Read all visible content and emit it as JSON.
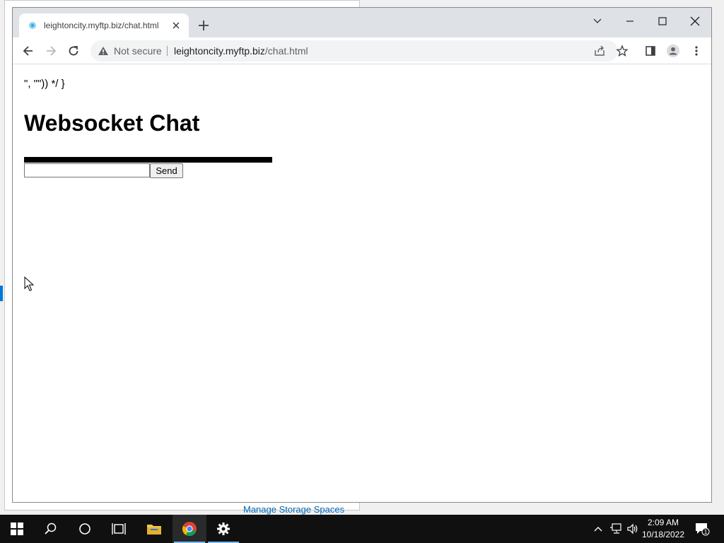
{
  "desktop": {
    "background_link": "Manage Storage Spaces"
  },
  "browser": {
    "tab": {
      "title": "leightoncity.myftp.biz/chat.html"
    },
    "omnibox": {
      "security_label": "Not secure",
      "url_host": "leightoncity.myftp.biz",
      "url_path": "/chat.html"
    }
  },
  "page": {
    "stray_text": "\", \"\")) */ }",
    "heading": "Websocket Chat",
    "message_input_value": "",
    "send_label": "Send"
  },
  "taskbar": {
    "time": "2:09 AM",
    "date": "10/18/2022",
    "notification_count": "1"
  },
  "colors": {
    "tabstrip": "#dee1e6",
    "taskbar": "#101010",
    "accent": "#0078d7"
  }
}
